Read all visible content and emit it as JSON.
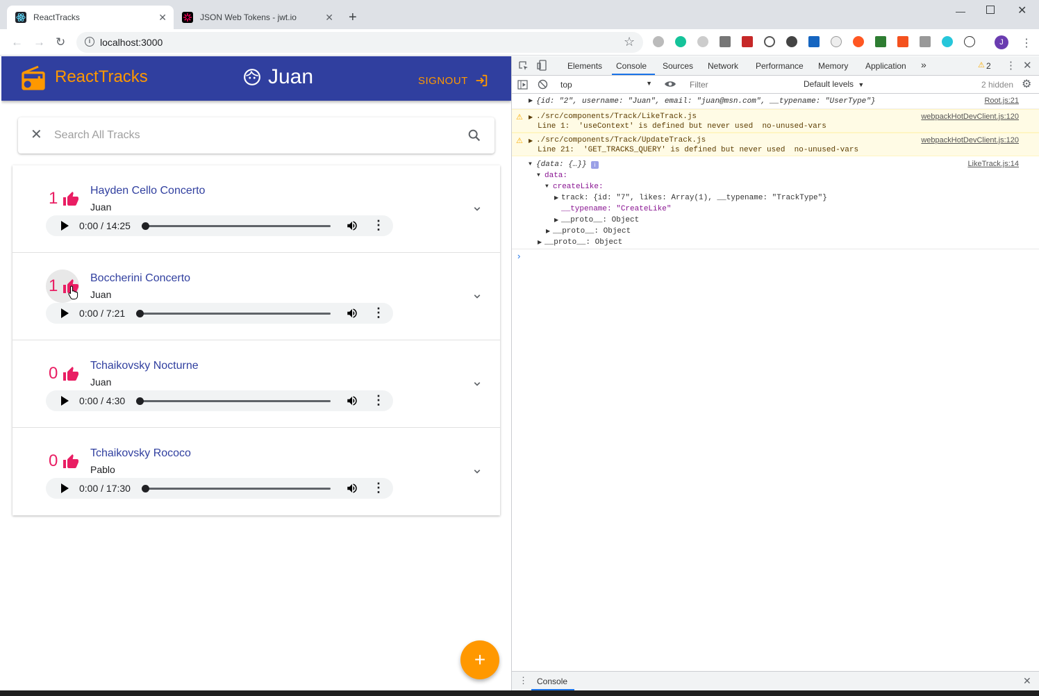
{
  "browser": {
    "tabs": [
      {
        "title": "ReactTracks",
        "active": true
      },
      {
        "title": "JSON Web Tokens - jwt.io",
        "active": false
      }
    ],
    "url": "localhost:3000"
  },
  "app": {
    "brand": "ReactTracks",
    "username": "Juan",
    "signout_label": "SIGNOUT",
    "search_placeholder": "Search All Tracks",
    "tracks": [
      {
        "likes": "1",
        "title": "Hayden Cello Concerto",
        "user": "Juan",
        "time": "0:00 / 14:25"
      },
      {
        "likes": "1",
        "title": "Boccherini Concerto",
        "user": "Juan",
        "time": "0:00 / 7:21"
      },
      {
        "likes": "0",
        "title": "Tchaikovsky Nocturne",
        "user": "Juan",
        "time": "0:00 / 4:30"
      },
      {
        "likes": "0",
        "title": "Tchaikovsky Rococo",
        "user": "Pablo",
        "time": "0:00 / 17:30"
      }
    ],
    "fab_label": "+"
  },
  "devtools": {
    "tabs": [
      "Elements",
      "Console",
      "Sources",
      "Network",
      "Performance",
      "Memory",
      "Application"
    ],
    "active_tab": "Console",
    "warning_count": "2",
    "context": "top",
    "filter_placeholder": "Filter",
    "levels": "Default levels",
    "hidden": "2 hidden",
    "console": {
      "l1_text": "{id: \"2\", username: \"Juan\", email: \"juan@msn.com\", __typename: \"UserType\"}",
      "l1_src": "Root.js:21",
      "w1_path": "./src/components/Track/LikeTrack.js",
      "w1_msg": "Line 1:  'useContext' is defined but never used  no-unused-vars",
      "w1_src": "webpackHotDevClient.js:120",
      "w2_path": "./src/components/Track/UpdateTrack.js",
      "w2_msg": "Line 21:  'GET_TRACKS_QUERY' is defined but never used  no-unused-vars",
      "w2_src": "webpackHotDevClient.js:120",
      "obj_head": "{data: {…}}",
      "obj_src": "LikeTrack.js:14",
      "obj_data": "data:",
      "obj_createLike": "createLike:",
      "obj_track": "track: {id: \"7\", likes: Array(1), __typename: \"TrackType\"}",
      "obj_typename": "__typename: \"CreateLike\"",
      "obj_proto1": "__proto__: Object",
      "obj_proto2": "__proto__: Object",
      "obj_proto3": "__proto__: Object"
    },
    "drawer_tab": "Console"
  },
  "colors": {
    "appbar": "#303f9f",
    "accent": "#ff9800",
    "like": "#e91e63"
  }
}
